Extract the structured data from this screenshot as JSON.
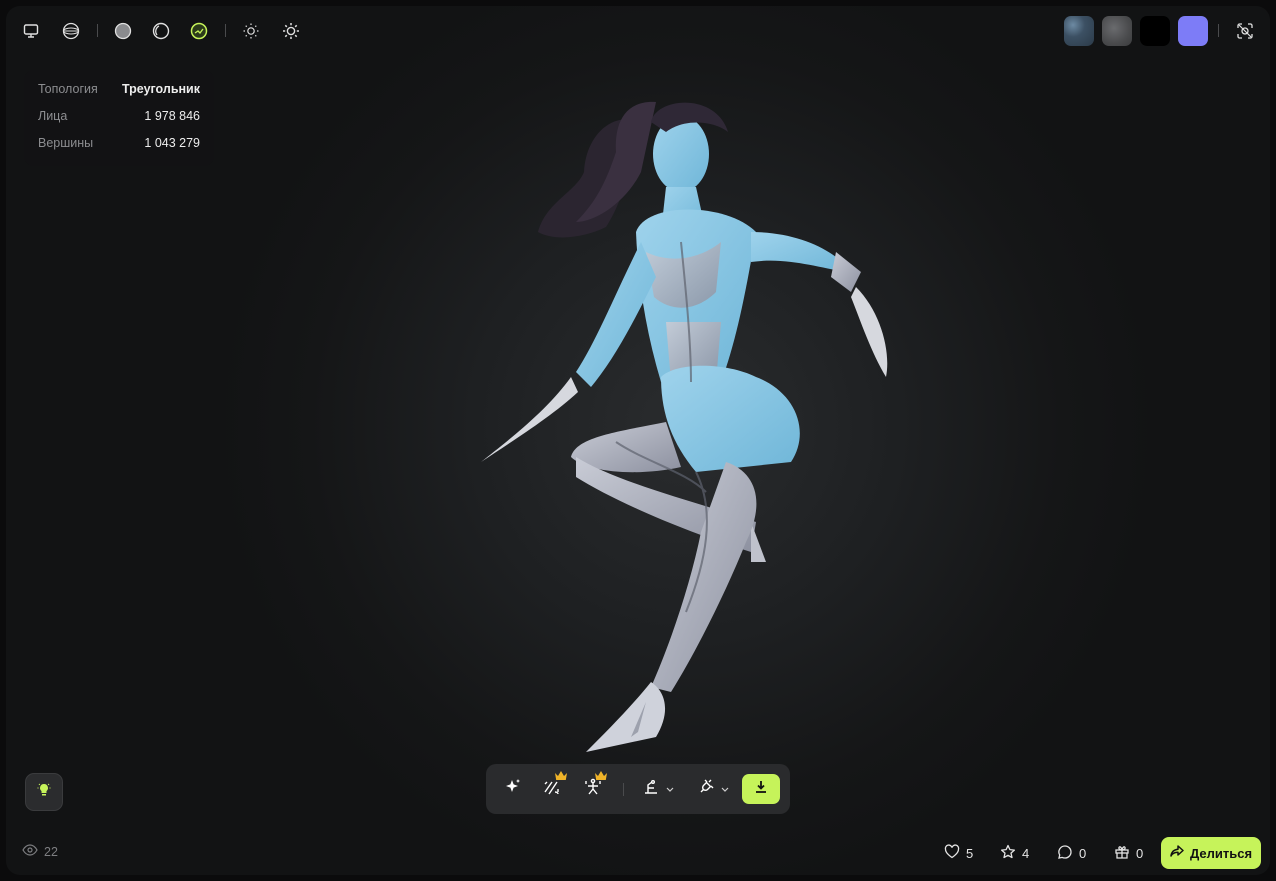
{
  "toolbar_top": {
    "icons": [
      "monitor-icon",
      "globe-wireframe-icon",
      "solid-sphere-icon",
      "outline-sphere-icon",
      "textured-sphere-icon",
      "light-dim-icon",
      "light-bright-icon"
    ]
  },
  "swatches": {
    "colors": [
      "#3a4a5a",
      "#4a4b4d",
      "#000000",
      "#7d7cf7"
    ],
    "settings_icon": "focus-settings-icon"
  },
  "stats": {
    "topology_label": "Топология",
    "topology_value": "Треугольник",
    "faces_label": "Лица",
    "faces_value": "1 978 846",
    "vertices_label": "Вершины",
    "vertices_value": "1 043 279"
  },
  "bottom_toolbar": {
    "tools": [
      "ai-sparkle-icon",
      "retopology-icon",
      "rigging-icon",
      "pose-icon",
      "plugin-icon"
    ],
    "download_icon": "download-icon"
  },
  "footer": {
    "views": "22",
    "likes": "5",
    "favorites": "4",
    "comments": "0",
    "gifts": "0",
    "share_label": "Делиться"
  },
  "colors": {
    "accent": "#c6f35a",
    "crown": "#f0b429"
  }
}
